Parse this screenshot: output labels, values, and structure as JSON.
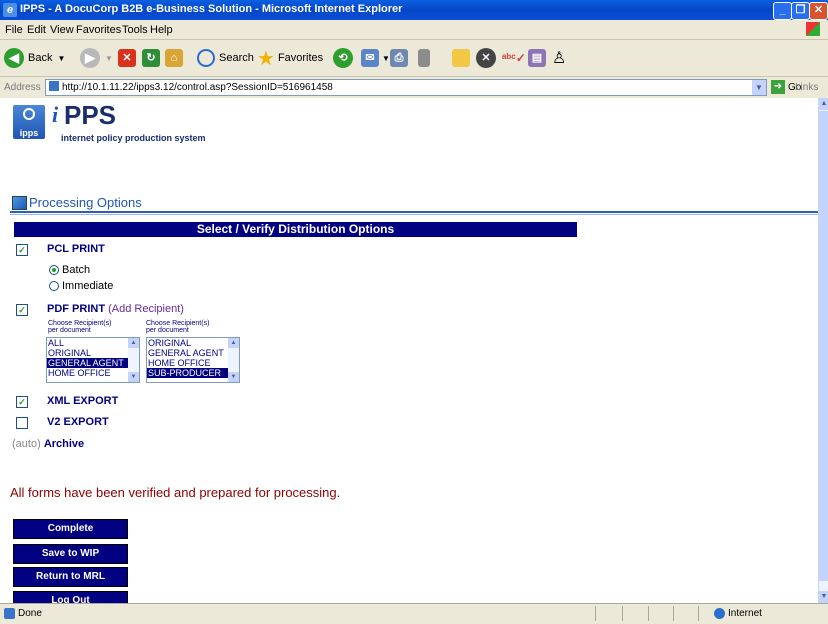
{
  "window": {
    "title": "IPPS - A DocuCorp B2B e-Business Solution - Microsoft Internet Explorer"
  },
  "menu": [
    "File",
    "Edit",
    "View",
    "Favorites",
    "Tools",
    "Help"
  ],
  "toolbar": {
    "back": "Back",
    "search": "Search",
    "favorites": "Favorites"
  },
  "address": {
    "label": "Address",
    "url": "http://10.1.11.22/ipps3.12/control.asp?SessionID=516961458",
    "go": "Go",
    "links": "Links"
  },
  "logo": {
    "icon_text": "ipps",
    "name": "PPS",
    "prefix": "i",
    "tagline": "internet policy production system"
  },
  "processing_title": "Processing Options",
  "section_header": "Select / Verify Distribution Options",
  "options": {
    "pcl": {
      "label": "PCL PRINT",
      "checked": true,
      "radios": [
        {
          "label": "Batch",
          "selected": true
        },
        {
          "label": "Immediate",
          "selected": false
        }
      ]
    },
    "pdf": {
      "label": "PDF PRINT",
      "checked": true,
      "add_recipient": "(Add Recipient)",
      "choose_label_1": "Choose Recipient(s)",
      "choose_label_2": "per document",
      "list1": [
        {
          "text": "ALL",
          "selected": false
        },
        {
          "text": "ORIGINAL",
          "selected": false
        },
        {
          "text": "GENERAL AGENT",
          "selected": true
        },
        {
          "text": "HOME OFFICE",
          "selected": false
        }
      ],
      "list2": [
        {
          "text": "ORIGINAL",
          "selected": false
        },
        {
          "text": "GENERAL AGENT",
          "selected": false
        },
        {
          "text": "HOME OFFICE",
          "selected": false
        },
        {
          "text": "SUB-PRODUCER",
          "selected": true
        }
      ]
    },
    "xml": {
      "label": "XML EXPORT",
      "checked": true
    },
    "v2": {
      "label": "V2 EXPORT",
      "checked": false
    }
  },
  "archive": {
    "prefix": "(auto)",
    "label": "Archive"
  },
  "verified_message": "All forms have been verified and prepared for processing.",
  "buttons": {
    "complete": "Complete",
    "save_wip": "Save to WIP",
    "return_mrl": "Return to MRL",
    "logout": "Log Out"
  },
  "status": {
    "text": "Done",
    "zone": "Internet"
  },
  "colors": {
    "navy": "#000080",
    "message": "#8b0000",
    "link_blue": "#1f56b3"
  }
}
